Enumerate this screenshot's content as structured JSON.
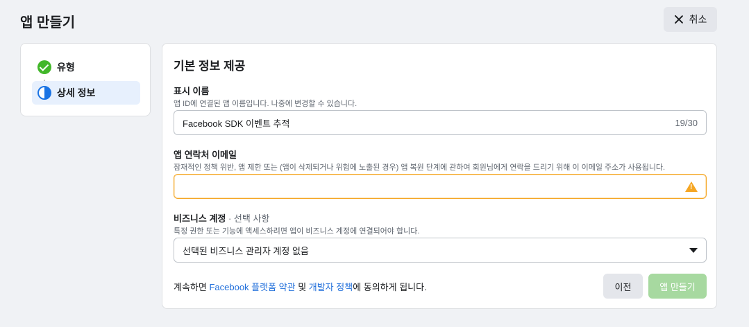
{
  "header": {
    "title": "앱 만들기",
    "cancel_label": "취소"
  },
  "steps": {
    "items": [
      {
        "label": "유형",
        "status": "complete"
      },
      {
        "label": "상세 정보",
        "status": "current"
      }
    ]
  },
  "form": {
    "section_title": "기본 정보 제공",
    "display_name": {
      "label": "표시 이름",
      "help": "앱 ID에 연결된 앱 이름입니다. 나중에 변경할 수 있습니다.",
      "value": "Facebook SDK 이벤트 추적",
      "counter": "19/30"
    },
    "contact_email": {
      "label": "앱 연락처 이메일",
      "help": "잠재적인 정책 위반, 앱 제한 또는 (앱이 삭제되거나 위험에 노출된 경우) 앱 복원 단계에 관하여 회원님에게 연락을 드리기 위해 이 이메일 주소가 사용됩니다.",
      "value": "",
      "warning_icon": "warning-icon"
    },
    "business_account": {
      "label": "비즈니스 계정",
      "optional": " · 선택 사항",
      "help": "특정 권한 또는 기능에 액세스하려면 앱이 비즈니스 계정에 연결되어야 합니다.",
      "selected": "선택된 비즈니스 관리자 계정 없음"
    },
    "terms": {
      "prefix": "계속하면 ",
      "platform_terms": "Facebook 플랫폼 약관",
      "and": " 및 ",
      "dev_policy": "개발자 정책",
      "suffix": "에 동의하게 됩니다."
    },
    "prev_label": "이전",
    "create_label": "앱 만들기"
  },
  "colors": {
    "accent": "#1b74e4",
    "complete": "#42b72a",
    "warning": "#f5a623",
    "link": "#216fdb",
    "create_disabled": "#a7d9a0"
  }
}
